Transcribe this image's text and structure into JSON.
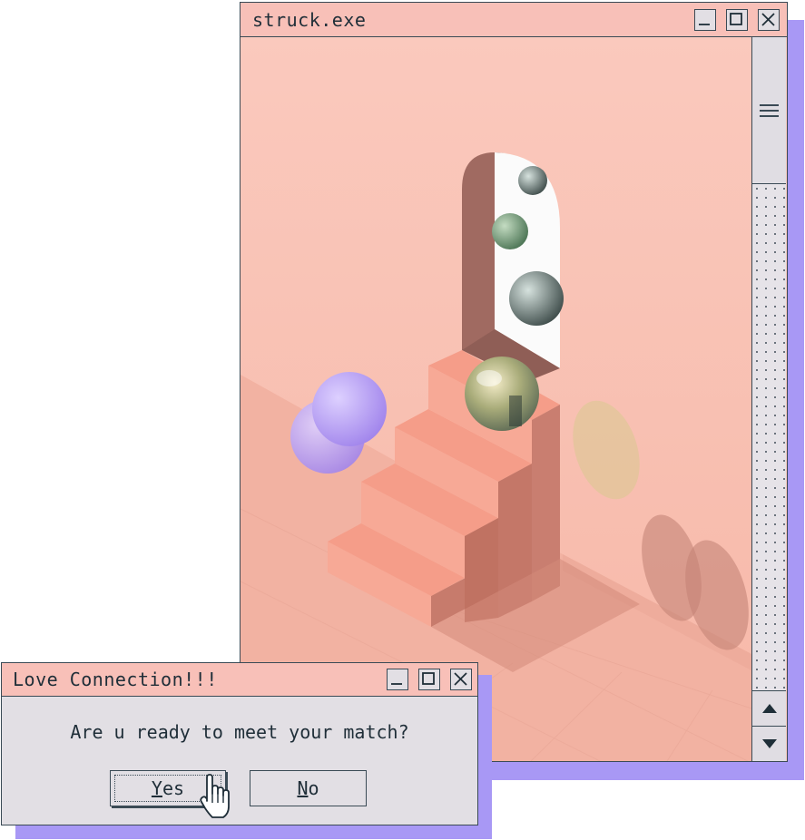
{
  "main_window": {
    "title": "struck.exe",
    "controls": {
      "minimize": "minimize-icon",
      "maximize": "maximize-icon",
      "close": "close-icon"
    }
  },
  "dialog": {
    "title": "Love Connection!!!",
    "message": "Are u ready to meet your match?",
    "yes_hotkey": "Y",
    "yes_rest": "es",
    "no_hotkey": "N",
    "no_rest": "o"
  },
  "colors": {
    "titlebar": "#f8c0b8",
    "window_face": "#e2dfe4",
    "shadow": "#a898f5",
    "outline": "#3a4a55"
  }
}
